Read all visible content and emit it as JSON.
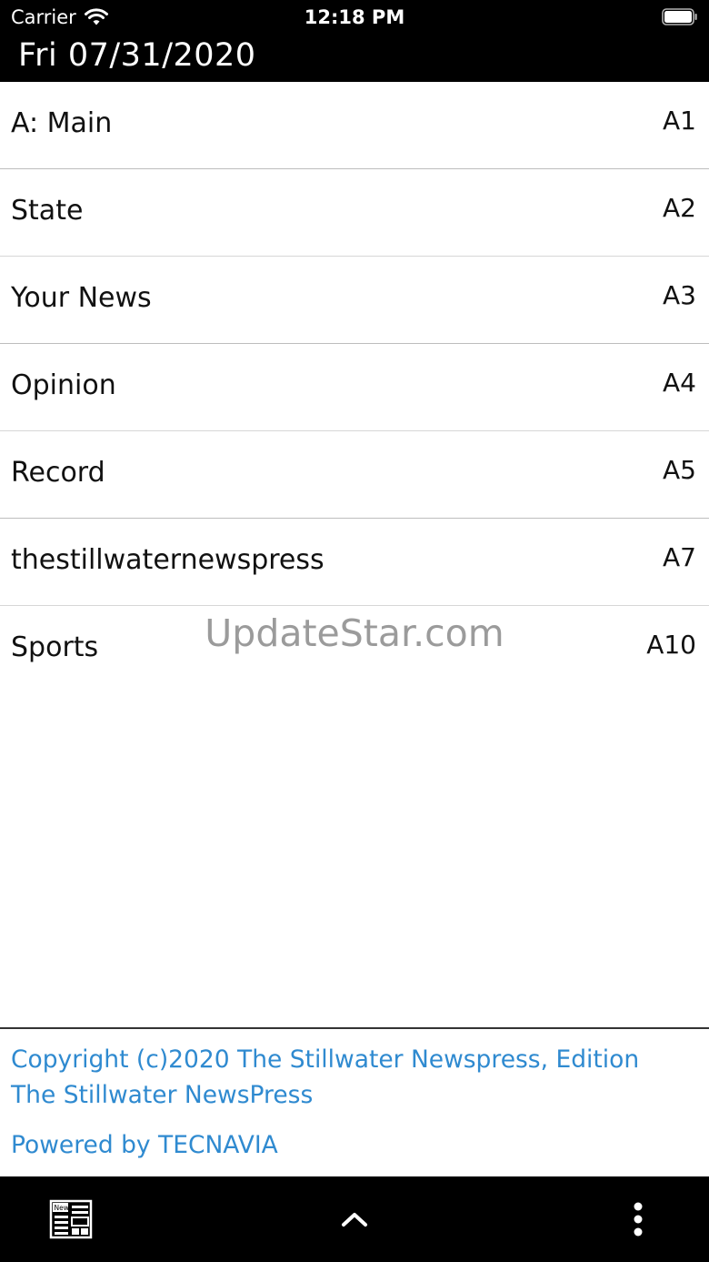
{
  "status_bar": {
    "carrier": "Carrier",
    "time": "12:18 PM",
    "wifi_icon": "wifi-icon",
    "battery_icon": "battery-icon"
  },
  "header": {
    "date": "Fri 07/31/2020"
  },
  "sections": [
    {
      "name": "A: Main",
      "page": "A1"
    },
    {
      "name": "State",
      "page": "A2"
    },
    {
      "name": "Your News",
      "page": "A3"
    },
    {
      "name": "Opinion",
      "page": "A4"
    },
    {
      "name": "Record",
      "page": "A5"
    },
    {
      "name": "thestillwaternewspress",
      "page": "A7"
    },
    {
      "name": "Sports",
      "page": "A10"
    }
  ],
  "watermark": "UpdateStar.com",
  "footer": {
    "copyright": "Copyright (c)2020 The Stillwater Newspress, Edition The Stillwater NewsPress",
    "powered": "Powered by TECNAVIA",
    "link_color": "#2f8ad0"
  },
  "bottom_bar": {
    "left_icon": "newspaper-icon",
    "center_icon": "chevron-up-icon",
    "right_icon": "more-vertical-icon"
  }
}
